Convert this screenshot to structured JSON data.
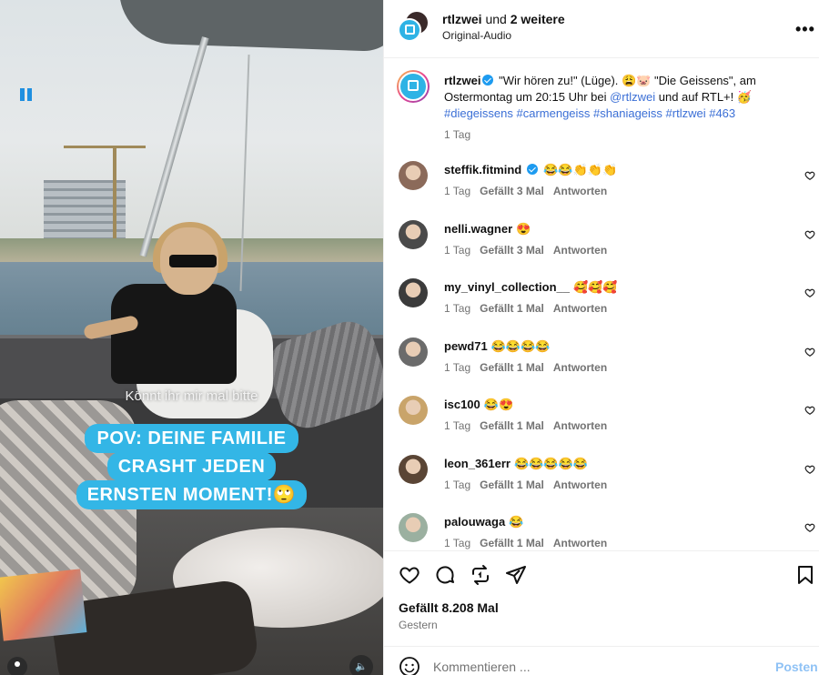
{
  "video": {
    "subtitle": "Könnt ihr mir mal bitte",
    "overlay_lines": [
      "POV: DEINE FAMILIE",
      "CRASHT JEDEN",
      "ERNSTEN MOMENT!🙄"
    ],
    "accent_color": "#33b6e6"
  },
  "header": {
    "username": "rtlzwei",
    "collab_suffix": " und ",
    "collab_count": "2 weitere",
    "audio_label": "Original-Audio",
    "more_icon": "more-horizontal-icon"
  },
  "caption": {
    "username": "rtlzwei",
    "text_part1": " \"Wir hören zu!\" (Lüge). 😩🐷 \"Die Geissens\", am Ostermontag um 20:15 Uhr bei ",
    "mention": "@rtlzwei",
    "text_part2": " und auf RTL+! 🥳 ",
    "hashtags": "#diegeissens #carmengeiss #shaniageiss #rtlzwei #463",
    "time": "1 Tag"
  },
  "comments": [
    {
      "username": "steffik.fitmind",
      "verified": true,
      "text": "😂😂👏👏👏",
      "time": "1 Tag",
      "likes": "Gefällt 3 Mal",
      "reply": "Antworten",
      "avatar_color": "#8b6a5a"
    },
    {
      "username": "nelli.wagner",
      "verified": false,
      "text": "😍",
      "time": "1 Tag",
      "likes": "Gefällt 3 Mal",
      "reply": "Antworten",
      "avatar_color": "#4a4a4a"
    },
    {
      "username": "my_vinyl_collection__",
      "verified": false,
      "text": "🥰🥰🥰",
      "time": "1 Tag",
      "likes": "Gefällt 1 Mal",
      "reply": "Antworten",
      "avatar_color": "#3b3b3b"
    },
    {
      "username": "pewd71",
      "verified": false,
      "text": "😂😂😂😂",
      "time": "1 Tag",
      "likes": "Gefällt 1 Mal",
      "reply": "Antworten",
      "avatar_color": "#6b6b6b"
    },
    {
      "username": "isc100",
      "verified": false,
      "text": "😂😍",
      "time": "1 Tag",
      "likes": "Gefällt 1 Mal",
      "reply": "Antworten",
      "avatar_color": "#c9a46a"
    },
    {
      "username": "leon_361err",
      "verified": false,
      "text": "😂😂😂😂😂",
      "time": "1 Tag",
      "likes": "Gefällt 1 Mal",
      "reply": "Antworten",
      "avatar_color": "#5a4535"
    },
    {
      "username": "palouwaga",
      "verified": false,
      "text": "😂",
      "time": "1 Tag",
      "likes": "Gefällt 1 Mal",
      "reply": "Antworten",
      "avatar_color": "#9bb0a0"
    }
  ],
  "actions": {
    "likes_text": "Gefällt 8.208 Mal",
    "date_text": "Gestern"
  },
  "composer": {
    "placeholder": "Kommentieren ...",
    "post_label": "Posten"
  }
}
